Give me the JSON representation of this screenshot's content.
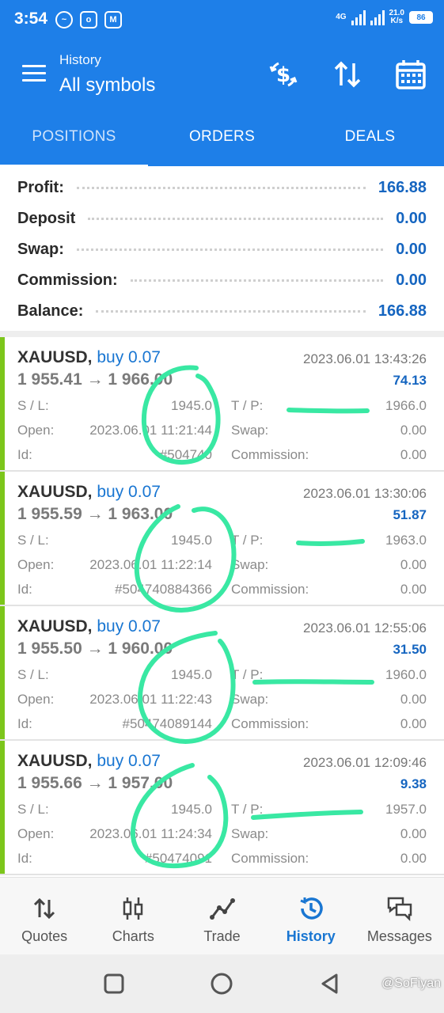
{
  "status_bar": {
    "time": "3:54",
    "network_type": "4G",
    "speed_value": "21.0",
    "speed_unit": "K/s",
    "battery": "86"
  },
  "app_bar": {
    "subtitle": "History",
    "title": "All symbols"
  },
  "tabs": [
    {
      "label": "POSITIONS",
      "active": true
    },
    {
      "label": "ORDERS",
      "active": false
    },
    {
      "label": "DEALS",
      "active": false
    }
  ],
  "summary": [
    {
      "label": "Profit:",
      "value": "166.88"
    },
    {
      "label": "Deposit",
      "value": "0.00"
    },
    {
      "label": "Swap:",
      "value": "0.00"
    },
    {
      "label": "Commission:",
      "value": "0.00"
    },
    {
      "label": "Balance:",
      "value": "166.88"
    }
  ],
  "deals": [
    {
      "symbol": "XAUUSD,",
      "side": "buy 0.07",
      "time": "2023.06.01 13:43:26",
      "open_price": "1 955.41",
      "close_price": "1 966.00",
      "profit": "74.13",
      "sl_label": "S / L:",
      "sl": "1945.0",
      "tp_label": "T / P:",
      "tp": "1966.0",
      "open_label": "Open:",
      "open_time": "2023.06.01 11:21:44",
      "swap_label": "Swap:",
      "swap": "0.00",
      "id_label": "Id:",
      "id": "#504740",
      "commission_label": "Commission:",
      "commission": "0.00"
    },
    {
      "symbol": "XAUUSD,",
      "side": "buy 0.07",
      "time": "2023.06.01 13:30:06",
      "open_price": "1 955.59",
      "close_price": "1 963.00",
      "profit": "51.87",
      "sl_label": "S / L:",
      "sl": "1945.0",
      "tp_label": "T / P:",
      "tp": "1963.0",
      "open_label": "Open:",
      "open_time": "2023.06.01 11:22:14",
      "swap_label": "Swap:",
      "swap": "0.00",
      "id_label": "Id:",
      "id": "#504740884366",
      "commission_label": "Commission:",
      "commission": "0.00"
    },
    {
      "symbol": "XAUUSD,",
      "side": "buy 0.07",
      "time": "2023.06.01 12:55:06",
      "open_price": "1 955.50",
      "close_price": "1 960.00",
      "profit": "31.50",
      "sl_label": "S / L:",
      "sl": "1945.0",
      "tp_label": "T / P:",
      "tp": "1960.0",
      "open_label": "Open:",
      "open_time": "2023.06.01 11:22:43",
      "swap_label": "Swap:",
      "swap": "0.00",
      "id_label": "Id:",
      "id": "#50474089144",
      "commission_label": "Commission:",
      "commission": "0.00"
    },
    {
      "symbol": "XAUUSD,",
      "side": "buy 0.07",
      "time": "2023.06.01 12:09:46",
      "open_price": "1 955.66",
      "close_price": "1 957.00",
      "profit": "9.38",
      "sl_label": "S / L:",
      "sl": "1945.0",
      "tp_label": "T / P:",
      "tp": "1957.0",
      "open_label": "Open:",
      "open_time": "2023.06.01 11:24:34",
      "swap_label": "Swap:",
      "swap": "0.00",
      "id_label": "Id:",
      "id": "#50474091",
      "commission_label": "Commission:",
      "commission": "0.00"
    }
  ],
  "bottom_nav": [
    {
      "label": "Quotes",
      "icon": "quotes-arrows-icon",
      "active": false
    },
    {
      "label": "Charts",
      "icon": "candlestick-icon",
      "active": false
    },
    {
      "label": "Trade",
      "icon": "trade-line-icon",
      "active": false
    },
    {
      "label": "History",
      "icon": "history-clock-icon",
      "active": true
    },
    {
      "label": "Messages",
      "icon": "messages-icon",
      "active": false
    }
  ],
  "watermark": "@SoFiyan",
  "colors": {
    "primary": "#1e7fe8",
    "profit_blue": "#1565c0",
    "buy_accent": "#7cc61b",
    "annotation": "#39e8a3"
  }
}
